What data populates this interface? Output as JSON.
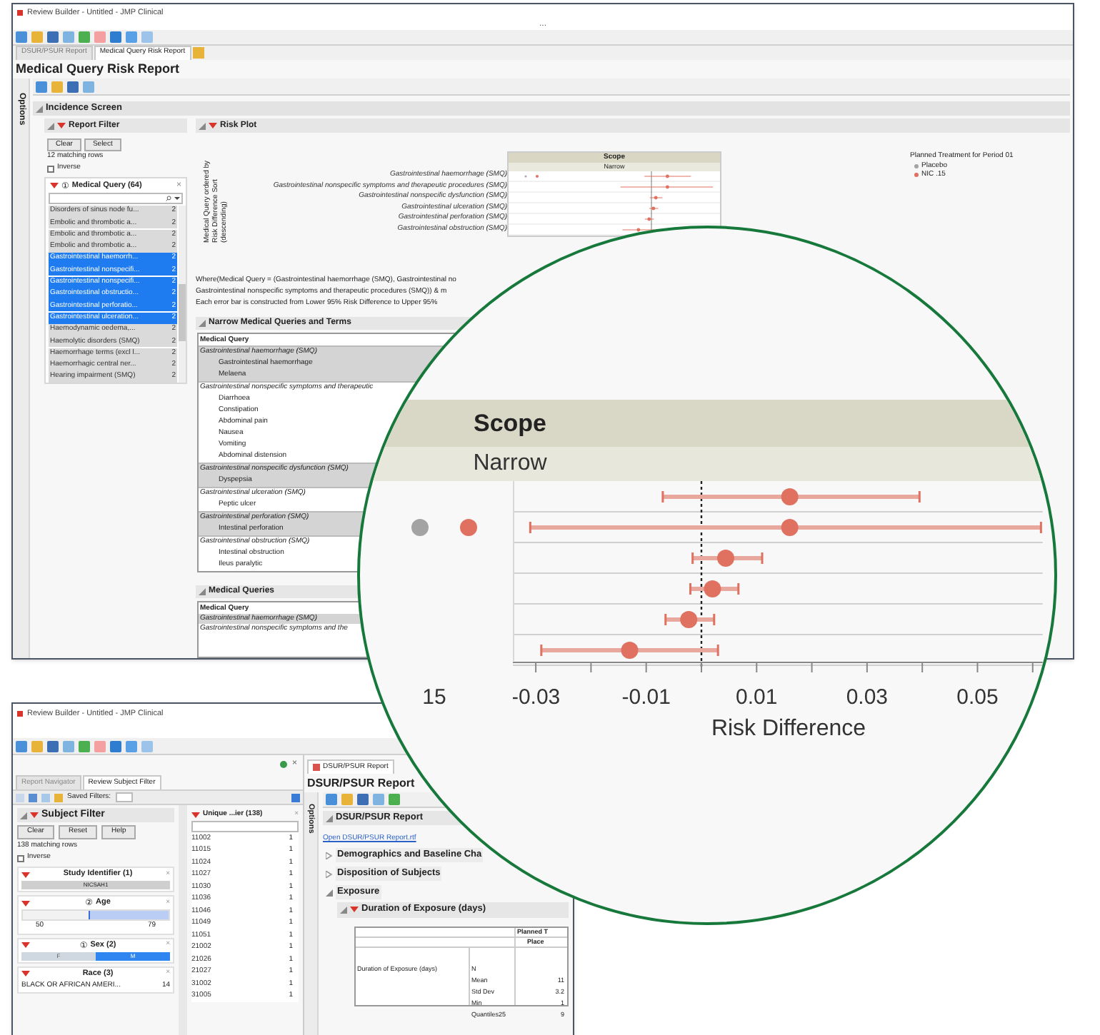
{
  "main_window": {
    "title": "Review Builder - Untitled - JMP Clinical",
    "overflow_mark": "...",
    "tabs": [
      {
        "label": "DSUR/PSUR Report",
        "selected": false
      },
      {
        "label": "Medical Query Risk Report",
        "selected": true
      }
    ],
    "heading": "Medical Query Risk Report",
    "options_label": "Options",
    "section": "Incidence Screen",
    "report_filter": {
      "title": "Report Filter",
      "buttons": [
        "Clear",
        "Select"
      ],
      "matching": "12 matching rows",
      "inverse": {
        "label": "Inverse",
        "checked": false
      },
      "list_badge": "①",
      "list_title": "Medical Query (64)",
      "close": "×",
      "items": [
        {
          "label": "Disorders of sinus node fu...",
          "count": "2",
          "selected": false
        },
        {
          "label": "Embolic and thrombotic a...",
          "count": "2",
          "selected": false
        },
        {
          "label": "Embolic and thrombotic a...",
          "count": "2",
          "selected": false
        },
        {
          "label": "Embolic and thrombotic a...",
          "count": "2",
          "selected": false
        },
        {
          "label": "Gastrointestinal haemorrh...",
          "count": "2",
          "selected": true
        },
        {
          "label": "Gastrointestinal nonspecifi...",
          "count": "2",
          "selected": true
        },
        {
          "label": "Gastrointestinal nonspecifi...",
          "count": "2",
          "selected": true
        },
        {
          "label": "Gastrointestinal obstructio...",
          "count": "2",
          "selected": true
        },
        {
          "label": "Gastrointestinal perforatio...",
          "count": "2",
          "selected": true
        },
        {
          "label": "Gastrointestinal ulceration...",
          "count": "2",
          "selected": true
        },
        {
          "label": "Haemodynamic oedema,...",
          "count": "2",
          "selected": false
        },
        {
          "label": "Haemolytic disorders (SMQ)",
          "count": "2",
          "selected": false
        },
        {
          "label": "Haemorrhage terms (excl l...",
          "count": "2",
          "selected": false
        },
        {
          "label": "Haemorrhagic central ner...",
          "count": "2",
          "selected": false
        },
        {
          "label": "Hearing impairment (SMQ)",
          "count": "2",
          "selected": false
        }
      ]
    },
    "risk_plot": {
      "title": "Risk Plot",
      "y_label": "Medical Query ordered by Risk Difference Sort (descending)",
      "rows": [
        "Gastrointestinal haemorrhage (SMQ)",
        "Gastrointestinal nonspecific symptoms and therapeutic procedures (SMQ)",
        "Gastrointestinal nonspecific dysfunction (SMQ)",
        "Gastrointestinal ulceration (SMQ)",
        "Gastrointestinal perforation (SMQ)",
        "Gastrointestinal obstruction (SMQ)"
      ],
      "thumbnail": {
        "header": "Scope",
        "subheader": "Narrow"
      },
      "legend": {
        "title": "Planned Treatment for Period 01",
        "items": [
          {
            "label": "Placebo",
            "color": "#a3a3a3"
          },
          {
            "label": "NIC .15",
            "color": "#e0705f"
          }
        ]
      },
      "notes": [
        "Where(Medical Query = (Gastrointestinal haemorrhage (SMQ), Gastrointestinal no",
        "Gastrointestinal nonspecific symptoms and therapeutic procedures (SMQ)) & m",
        "Each error bar is constructed from Lower 95% Risk Difference to Upper 95%"
      ]
    },
    "narrow_table": {
      "title": "Narrow Medical Queries and Terms",
      "column": "Medical Query",
      "groups": [
        {
          "label": "Gastrointestinal haemorrhage (SMQ)",
          "children": [
            {
              "label": "Gastrointestinal haemorrhage"
            },
            {
              "label": "Melaena"
            }
          ]
        },
        {
          "label": "Gastrointestinal nonspecific symptoms and therapeutic",
          "children": [
            {
              "label": "Diarrhoea"
            },
            {
              "label": "Constipation"
            },
            {
              "label": "Abdominal pain"
            },
            {
              "label": "Nausea"
            },
            {
              "label": "Vomiting"
            },
            {
              "label": "Abdominal distension"
            }
          ]
        },
        {
          "label": "Gastrointestinal nonspecific dysfunction (SMQ)",
          "children": [
            {
              "label": "Dyspepsia"
            }
          ]
        },
        {
          "label": "Gastrointestinal ulceration (SMQ)",
          "children": [
            {
              "label": "Peptic ulcer"
            }
          ]
        },
        {
          "label": "Gastrointestinal perforation (SMQ)",
          "children": [
            {
              "label": "Intestinal perforation"
            }
          ]
        },
        {
          "label": "Gastrointestinal obstruction (SMQ)",
          "children": [
            {
              "label": "Intestinal obstruction"
            },
            {
              "label": "Ileus paralytic"
            }
          ]
        }
      ]
    },
    "queries_table": {
      "title": "Medical Queries",
      "column": "Medical Query",
      "rows": [
        "Gastrointestinal haemorrhage (SMQ)",
        "Gastrointestinal nonspecific symptoms and the"
      ]
    }
  },
  "magnifier": {
    "header": "Scope",
    "subheader": "Narrow",
    "percent_tick": "15",
    "chart_data": {
      "type": "scatter",
      "orientation": "horizontal",
      "xlabel": "Risk Difference",
      "xlim": [
        -0.0342,
        0.0618
      ],
      "ref_lines": [
        {
          "axis": "x",
          "value": 0
        }
      ],
      "categories": [
        null,
        null,
        null,
        null,
        null,
        null
      ],
      "xticks": [
        {
          "value": -0.03,
          "label": "-0.03"
        },
        {
          "value": -0.01,
          "label": "-0.01"
        },
        {
          "value": 0.01,
          "label": "0.01"
        },
        {
          "value": 0.03,
          "label": "0.03"
        },
        {
          "value": 0.05,
          "label": "0.05"
        }
      ],
      "series": [
        {
          "color": "#e0705f",
          "values": [
            0.016,
            0.016,
            0.0044,
            0.002,
            -0.0023,
            -0.013
          ],
          "errors": [
            [
              -0.007,
              0.0395
            ],
            [
              -0.031,
              0.0615
            ],
            [
              -0.0016,
              0.011
            ],
            [
              -0.002,
              0.0067
            ],
            [
              -0.0065,
              0.0023
            ],
            [
              -0.029,
              0.003
            ]
          ]
        }
      ]
    }
  },
  "second_window": {
    "title": "Review Builder - Untitled - JMP Clinical",
    "close": "×",
    "tabs": [
      {
        "label": "Report Navigator",
        "selected": false
      },
      {
        "label": "Review Subject Filter",
        "selected": true
      }
    ],
    "saved_filters": "Saved Filters:",
    "subject_filter": {
      "title": "Subject Filter",
      "buttons": [
        "Clear",
        "Reset",
        "Help"
      ],
      "matching": "138 matching rows",
      "inverse": {
        "label": "Inverse",
        "checked": false
      },
      "cards": [
        {
          "kind": "values",
          "title": "Study Identifier (1)",
          "close": "×",
          "value": "NICSAH1"
        },
        {
          "kind": "range",
          "badge": "②",
          "title": "Age",
          "close": "×",
          "level": 0.55,
          "min": "50",
          "max": "79"
        },
        {
          "kind": "split",
          "badge": "①",
          "title": "Sex (2)",
          "close": "×",
          "options": [
            {
              "label": "F",
              "selected": false
            },
            {
              "label": "M",
              "selected": true
            }
          ]
        },
        {
          "kind": "list",
          "title": "Race (3)",
          "close": "×",
          "entry": "BLACK OR AFRICAN AMERI...",
          "count": "14"
        }
      ]
    },
    "id_list": {
      "title": "Unique ...ier (138)",
      "close": "×",
      "rows": [
        {
          "id": "11002",
          "count": "1"
        },
        {
          "id": "11015",
          "count": "1"
        },
        {
          "id": "11024",
          "count": "1"
        },
        {
          "id": "11027",
          "count": "1"
        },
        {
          "id": "11030",
          "count": "1"
        },
        {
          "id": "11036",
          "count": "1"
        },
        {
          "id": "11046",
          "count": "1"
        },
        {
          "id": "11049",
          "count": "1"
        },
        {
          "id": "11051",
          "count": "1"
        },
        {
          "id": "21002",
          "count": "1"
        },
        {
          "id": "21026",
          "count": "1"
        },
        {
          "id": "21027",
          "count": "1"
        },
        {
          "id": "31002",
          "count": "1"
        },
        {
          "id": "31005",
          "count": "1"
        }
      ]
    },
    "report_tab": "DSUR/PSUR Report",
    "heading": "DSUR/PSUR Report",
    "options_label": "Options",
    "section": "DSUR/PSUR Report",
    "link": "Open DSUR/PSUR Report.rtf",
    "outline": [
      {
        "label": "Demographics and Baseline Cha",
        "expanded": false
      },
      {
        "label": "Disposition of Subjects",
        "expanded": false
      },
      {
        "label": "Exposure",
        "expanded": true
      }
    ],
    "subsection": {
      "title": "Duration of Exposure (days)",
      "expanded": true
    },
    "table": {
      "header": "Planned T",
      "subheader": "Place",
      "row_label": "Duration of Exposure (days)",
      "rows": [
        {
          "stat": "N"
        },
        {
          "stat": "Mean",
          "value": "11"
        },
        {
          "stat": "Std Dev",
          "value": "3.2"
        },
        {
          "stat": "Min",
          "value": "1"
        },
        {
          "stat": "Quantiles25",
          "value": "9"
        }
      ]
    }
  }
}
